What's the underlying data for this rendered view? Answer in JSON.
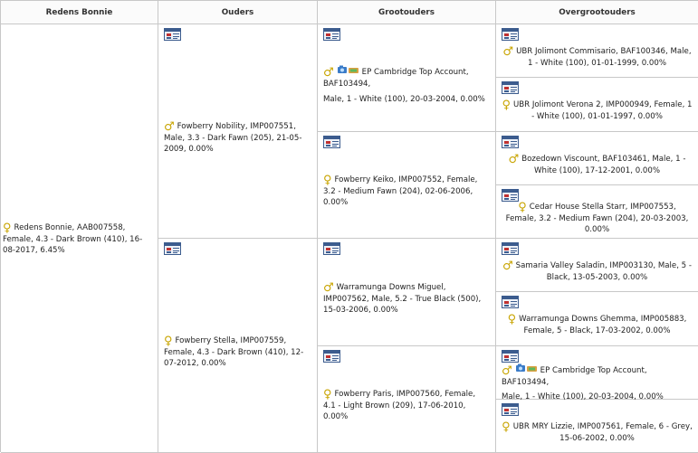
{
  "headers": [
    "Redens Bonnie",
    "Ouders",
    "Grootouders",
    "Overgrootouders"
  ],
  "subject": {
    "sex": "female",
    "text": "Redens Bonnie, AAB007558, Female, 4.3 - Dark Brown (410), 16-08-2017, 6.45%"
  },
  "parents": [
    {
      "sex": "male",
      "text": "Fowberry Nobility, IMP007551, Male, 3.3 - Dark Fawn (205), 21-05-2009, 0.00%"
    },
    {
      "sex": "female",
      "text": "Fowberry Stella, IMP007559, Female, 4.3 - Dark Brown (410), 12-07-2012, 0.00%"
    }
  ],
  "grandparents": [
    {
      "sex": "male",
      "camera": true,
      "text_a": "EP Cambridge Top Account, BAF103494,",
      "text_b": "Male, 1 - White (100), 20-03-2004, 0.00%"
    },
    {
      "sex": "female",
      "text": "Fowberry Keiko, IMP007552, Female, 3.2 - Medium Fawn (204), 02-06-2006, 0.00%"
    },
    {
      "sex": "male",
      "text": "Warramunga Downs Miguel, IMP007562, Male, 5.2 - True Black (500), 15-03-2006, 0.00%"
    },
    {
      "sex": "female",
      "text": "Fowberry Paris, IMP007560, Female, 4.1 - Light Brown (209), 17-06-2010, 0.00%"
    }
  ],
  "great_grandparents": [
    {
      "sex": "male",
      "text": "UBR Jolimont Commisario, BAF100346, Male, 1 - White (100), 01-01-1999, 0.00%"
    },
    {
      "sex": "female",
      "text": "UBR Jolimont Verona 2, IMP000949, Female, 1 - White (100), 01-01-1997, 0.00%"
    },
    {
      "sex": "male",
      "text": "Bozedown Viscount, BAF103461, Male, 1 - White (100), 17-12-2001, 0.00%"
    },
    {
      "sex": "female",
      "text": "Cedar House Stella Starr, IMP007553, Female, 3.2 - Medium Fawn (204), 20-03-2003, 0.00%"
    },
    {
      "sex": "male",
      "text": "Samaria Valley Saladin, IMP003130, Male, 5 - Black, 13-05-2003, 0.00%"
    },
    {
      "sex": "female",
      "text": "Warramunga Downs Ghemma, IMP005883, Female, 5 - Black, 17-03-2002, 0.00%"
    },
    {
      "sex": "male",
      "camera": true,
      "text_a": "EP Cambridge Top Account, BAF103494,",
      "text_b": "Male, 1 - White (100), 20-03-2004, 0.00%"
    },
    {
      "sex": "female",
      "text": "UBR MRY Lizzie, IMP007561, Female, 6 - Grey, 15-06-2002, 0.00%"
    }
  ],
  "symbols": {
    "male": "♂",
    "female": "♀",
    "male_color": "#c8a400",
    "female_color": "#c8a400",
    "border_color": "#c8c8c8"
  },
  "icons": {
    "card": "pedigree-card-icon",
    "camera": "camera-icon"
  }
}
